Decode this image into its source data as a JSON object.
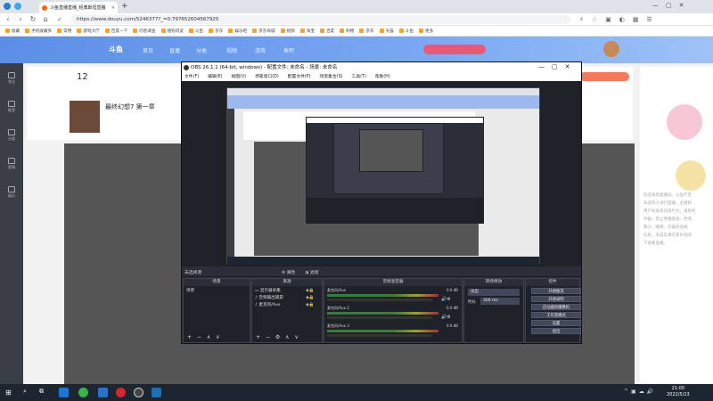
{
  "browser": {
    "tab_title": "斗鱼直播直播_经典斯坦直播",
    "new_tab_label": "+",
    "url": "https://www.douyu.com/5246377?_=0.797652604567925",
    "bookmarks": [
      "收藏",
      "手机收藏夹",
      "常用",
      "游戏大厅",
      "百度一下",
      "问卷调查",
      "搜狗浏览",
      "斗鱼",
      "京东",
      "娱乐吧",
      "京东商城",
      "视频",
      "淘宝",
      "百度",
      "购物",
      "京东",
      "天猫",
      "斗鱼",
      "更多"
    ]
  },
  "douyu": {
    "logo": "斗鱼",
    "nav": [
      "首页",
      "直播",
      "分类",
      "视频",
      "游戏",
      "鱼吧"
    ],
    "sidebar": [
      "关注",
      "推荐",
      "分类",
      "视频",
      "娱乐"
    ],
    "stat_number": "12",
    "stream_title": "最终幻想7 第一章",
    "chat_lines": [
      "欢迎来到直播间，斗鱼严禁",
      "未成年人进行直播，主播和",
      "用户如发现违规行为，请及时",
      "举报，禁止传播低俗、色情、",
      "暴力、赌博、诈骗等违规",
      "信息，未成年请在家长陪同",
      "下观看直播。"
    ]
  },
  "obs": {
    "title": "OBS 26.1.1 (64-bit, windows) - 配置文件: 未命名 - 场景: 未命名",
    "menu": [
      "文件(F)",
      "编辑(E)",
      "视图(V)",
      "停靠窗口(D)",
      "配置文件(P)",
      "场景集合(S)",
      "工具(T)",
      "帮助(H)"
    ],
    "status_text": "未选择源",
    "status_buttons": [
      "属性",
      "滤镜"
    ],
    "scenes_header": "场景",
    "scenes": [
      "场景"
    ],
    "sources_header": "来源",
    "sources": [
      "显示器采集",
      "音频输出捕获",
      "麦克风/Aux"
    ],
    "mixer_header": "音频混音器",
    "mixer": [
      {
        "name": "麦克风/Aux",
        "db": "0.0 dB"
      },
      {
        "name": "麦克风/Aux 2",
        "db": "0.0 dB"
      },
      {
        "name": "麦克风/Aux 3",
        "db": "0.0 dB"
      }
    ],
    "transition_header": "转场特效",
    "transition_type": "淡出",
    "transition_duration_label": "时长",
    "transition_duration": "300 ms",
    "controls_header": "控件",
    "controls": [
      "开始推流",
      "开始录制",
      "启动虚拟摄像机",
      "工作室模式",
      "设置",
      "退出"
    ],
    "footer_icons": "+ − ∧ ∨"
  },
  "taskbar": {
    "time": "21:00",
    "date": "2022/5/23"
  }
}
